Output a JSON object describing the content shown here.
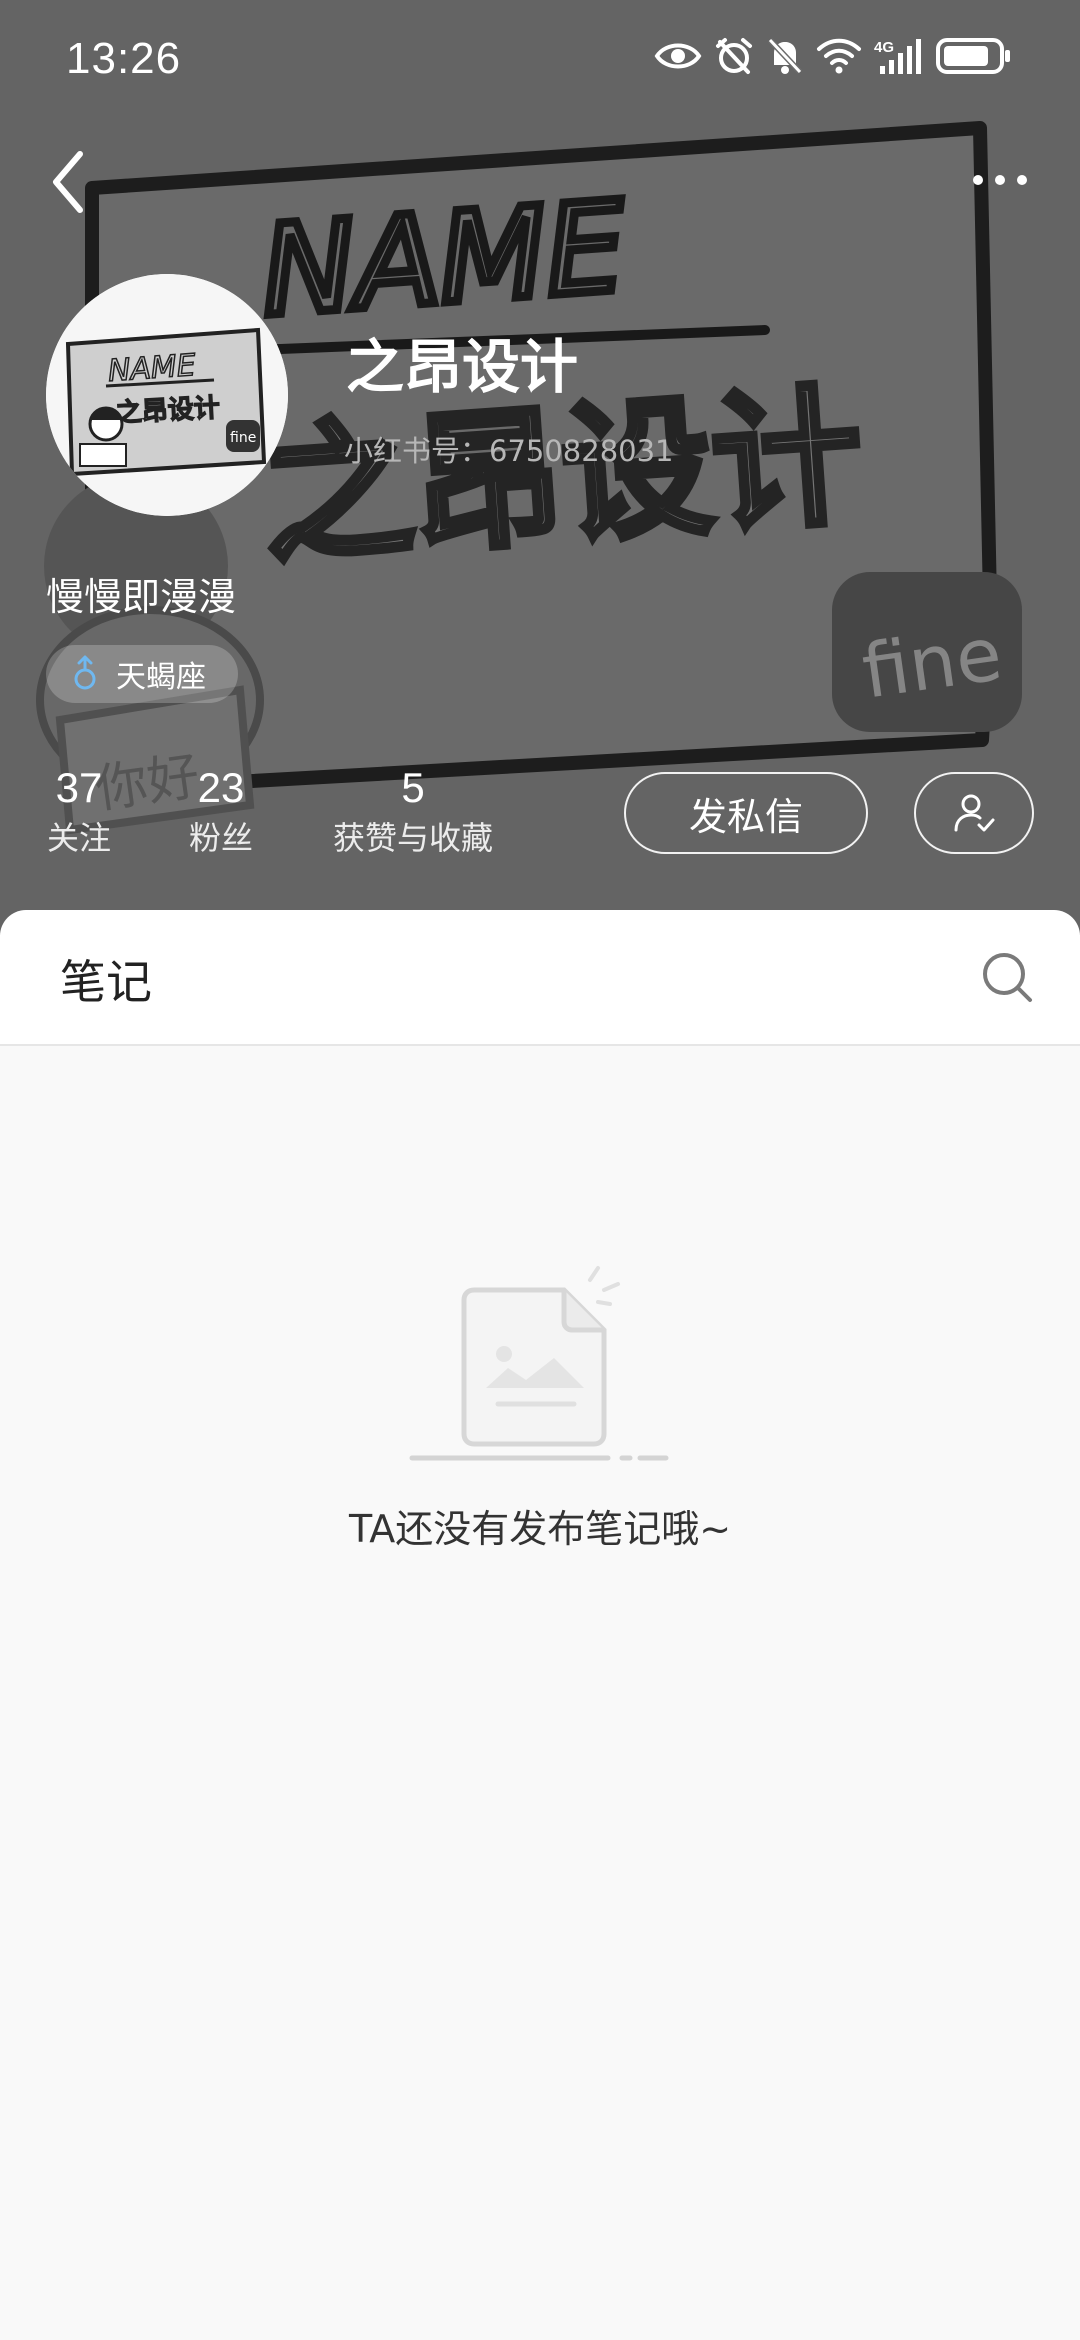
{
  "status_bar": {
    "time": "13:26",
    "icons": [
      "eye-icon",
      "alarm-icon",
      "mute-icon",
      "wifi-icon",
      "signal-4g-icon",
      "battery-icon"
    ],
    "network": "4G"
  },
  "nav": {
    "back_icon": "chevron-left-icon",
    "more_icon": "more-dots-icon"
  },
  "cover_art": {
    "heading": "NAME",
    "title": "之昂设计",
    "badge": "fine",
    "sign": "你好"
  },
  "profile": {
    "username": "之昂设计",
    "id_text": "小红书号：6750828031",
    "bio": "慢慢即漫漫",
    "zodiac": "天蝎座",
    "gender_icon": "male-icon",
    "gender_color": "#6fb8f0"
  },
  "stats": [
    {
      "value": "37",
      "label": "关注"
    },
    {
      "value": "23",
      "label": "粉丝"
    },
    {
      "value": "5",
      "label": "获赞与收藏"
    }
  ],
  "actions": {
    "message_label": "发私信",
    "follow_icon": "user-check-icon"
  },
  "notes": {
    "tab_label": "笔记",
    "search_icon": "search-icon",
    "empty_message": "TA还没有发布笔记哦~"
  }
}
